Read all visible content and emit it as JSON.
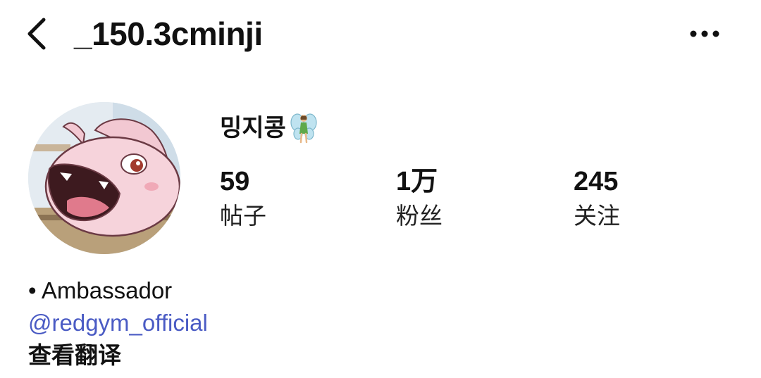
{
  "header": {
    "back_icon": "chevron-left-icon",
    "username": "_150.3cminji",
    "more_icon": "more-horizontal-icon"
  },
  "profile": {
    "avatar_icon": "avatar-pink-cartoon-creature",
    "display_name": "밍지콩",
    "name_emoji_icon": "fairy-emoji-icon"
  },
  "stats": [
    {
      "value": "59",
      "label": "帖子"
    },
    {
      "value": "1万",
      "label": "粉丝"
    },
    {
      "value": "245",
      "label": "关注"
    }
  ],
  "bio": {
    "line1": "• Ambassador",
    "mention": "@redgym_official",
    "translate": "查看翻译",
    "link_color": "#4a5bc4"
  }
}
